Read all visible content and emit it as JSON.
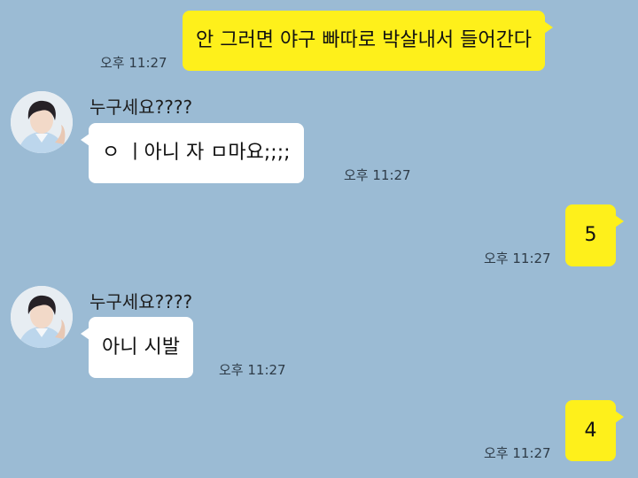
{
  "messages": [
    {
      "side": "me",
      "text": "안 그러면 야구 빠따로 박살내서 들어간다",
      "time": "오후 11:27"
    },
    {
      "side": "them",
      "sender": "누구세요????",
      "avatar": "profile-photo",
      "text": "ㅇ ㅣ아니 자 ㅁ마요;;;;",
      "time": "오후 11:27"
    },
    {
      "side": "me",
      "text": "5",
      "time": "오후 11:27"
    },
    {
      "side": "them",
      "sender": "누구세요????",
      "avatar": "profile-photo",
      "text": "아니 시발",
      "time": "오후 11:27"
    },
    {
      "side": "me",
      "text": "4",
      "time": "오후 11:27"
    }
  ],
  "colors": {
    "background": "#9bbbd4",
    "my_bubble": "#fef01b",
    "their_bubble": "#ffffff"
  }
}
